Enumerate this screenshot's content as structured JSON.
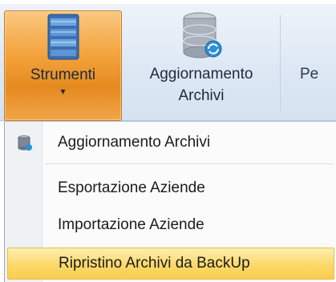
{
  "ribbon": {
    "buttons": [
      {
        "label": "Strumenti",
        "caret": "▾",
        "icon": "database-tools-icon"
      },
      {
        "label_line1": "Aggiornamento",
        "label_line2": "Archivi",
        "icon": "database-refresh-icon"
      },
      {
        "label": "Pe"
      }
    ]
  },
  "menu": {
    "items": [
      {
        "label": "Aggiornamento Archivi",
        "icon": "database-refresh-icon"
      },
      {
        "label": "Esportazione Aziende"
      },
      {
        "label": "Importazione Aziende"
      },
      {
        "label": "Ripristino Archivi da BackUp",
        "highlighted": true
      }
    ]
  },
  "colors": {
    "ribbon_bg": "#dce7f4",
    "active_button": "#f4a33d",
    "highlight": "#fbd96a",
    "text": "#1b1b1b"
  }
}
